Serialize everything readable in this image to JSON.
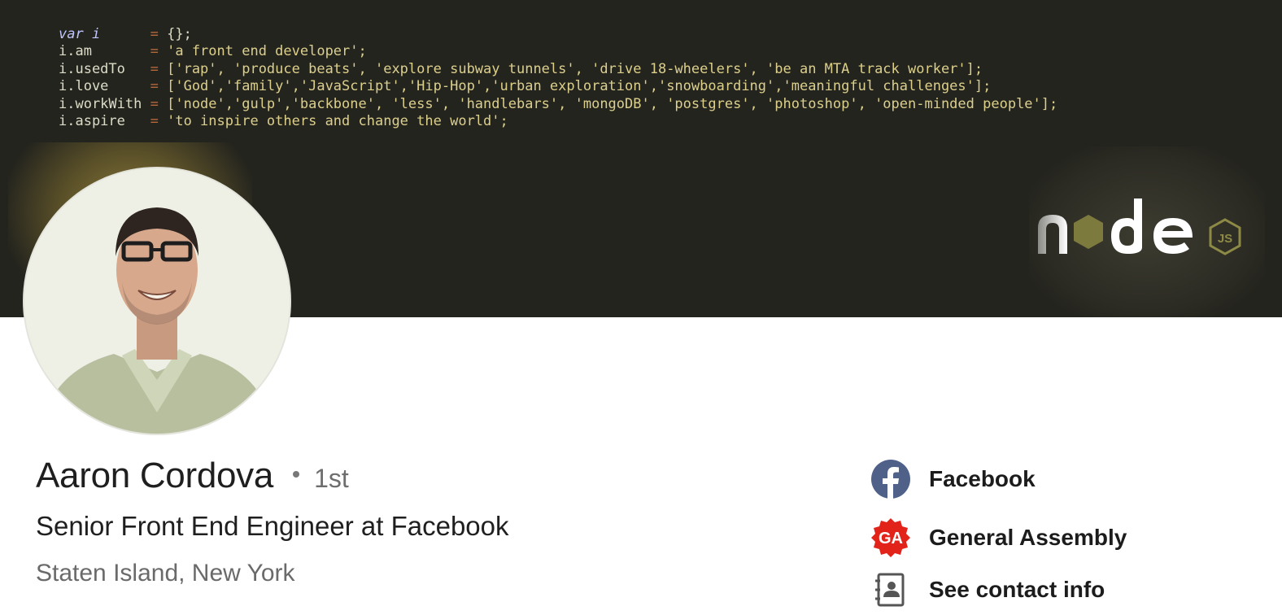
{
  "banner": {
    "code_lines": [
      {
        "lhs": "var i     ",
        "kw": true,
        "rhs": "{};",
        "rhs_type": "pun"
      },
      {
        "lhs": "i.am      ",
        "kw": false,
        "rhs": "'a front end developer';",
        "rhs_type": "str"
      },
      {
        "lhs": "i.usedTo  ",
        "kw": false,
        "rhs": "['rap', 'produce beats', 'explore subway tunnels', 'drive 18-wheelers', 'be an MTA track worker'];",
        "rhs_type": "str"
      },
      {
        "lhs": "i.love    ",
        "kw": false,
        "rhs": "['God','family','JavaScript','Hip-Hop','urban exploration','snowboarding','meaningful challenges'];",
        "rhs_type": "str"
      },
      {
        "lhs": "i.workWith",
        "kw": false,
        "rhs": "['node','gulp','backbone', 'less', 'handlebars', 'mongoDB', 'postgres', 'photoshop', 'open-minded people'];",
        "rhs_type": "str"
      },
      {
        "lhs": "i.aspire  ",
        "kw": false,
        "rhs": "'to inspire others and change the world';",
        "rhs_type": "str"
      }
    ],
    "logo_text": "node",
    "logo_badge": "JS"
  },
  "profile": {
    "name": "Aaron Cordova",
    "degree": "1st",
    "headline": "Senior Front End Engineer at Facebook",
    "location": "Staten Island, New York"
  },
  "links": [
    {
      "label": "Facebook",
      "icon": "facebook-icon"
    },
    {
      "label": "General Assembly",
      "icon": "general-assembly-icon",
      "icon_text": "GA"
    },
    {
      "label": "See contact info",
      "icon": "contact-book-icon"
    }
  ],
  "colors": {
    "banner_bg": "#24241e",
    "code_string": "#dccf8c",
    "code_operator": "#b5683a",
    "facebook_blue": "#3b5998",
    "ga_red": "#e2231a"
  }
}
